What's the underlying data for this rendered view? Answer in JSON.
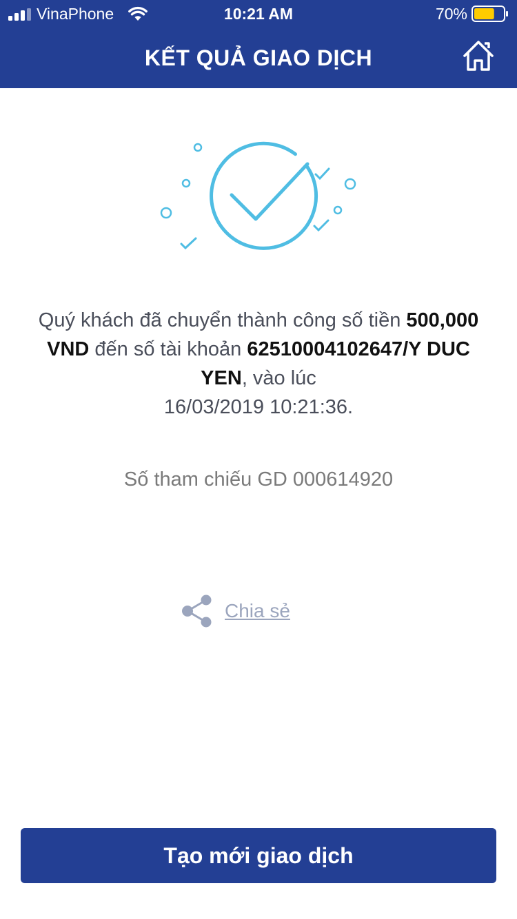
{
  "status_bar": {
    "carrier": "VinaPhone",
    "time": "10:21 AM",
    "battery_percent": "70%",
    "battery_level": 0.7,
    "icons": [
      "signal-icon",
      "wifi-icon",
      "battery-icon"
    ]
  },
  "header": {
    "title": "KẾT QUẢ GIAO DỊCH",
    "right_icon": "home-icon"
  },
  "illustration": {
    "icon": "success-check-icon",
    "color": "#4fbde3"
  },
  "message": {
    "part1": "Quý khách đã chuyển thành công số tiền ",
    "amount": "500,000 VND",
    "part2": " đến số tài khoản ",
    "account": "62510004102647/Y DUC YEN",
    "part3": ", vào lúc ",
    "datetime": "16/03/2019 10:21:36."
  },
  "reference": {
    "text": "Số tham chiếu GD 000614920"
  },
  "share": {
    "icon": "share-icon",
    "label": "Chia sẻ"
  },
  "actions": {
    "new_transaction_label": "Tạo mới giao dịch"
  },
  "colors": {
    "brand": "#233f94",
    "accent": "#4fbde3",
    "battery": "#ffcc00"
  }
}
